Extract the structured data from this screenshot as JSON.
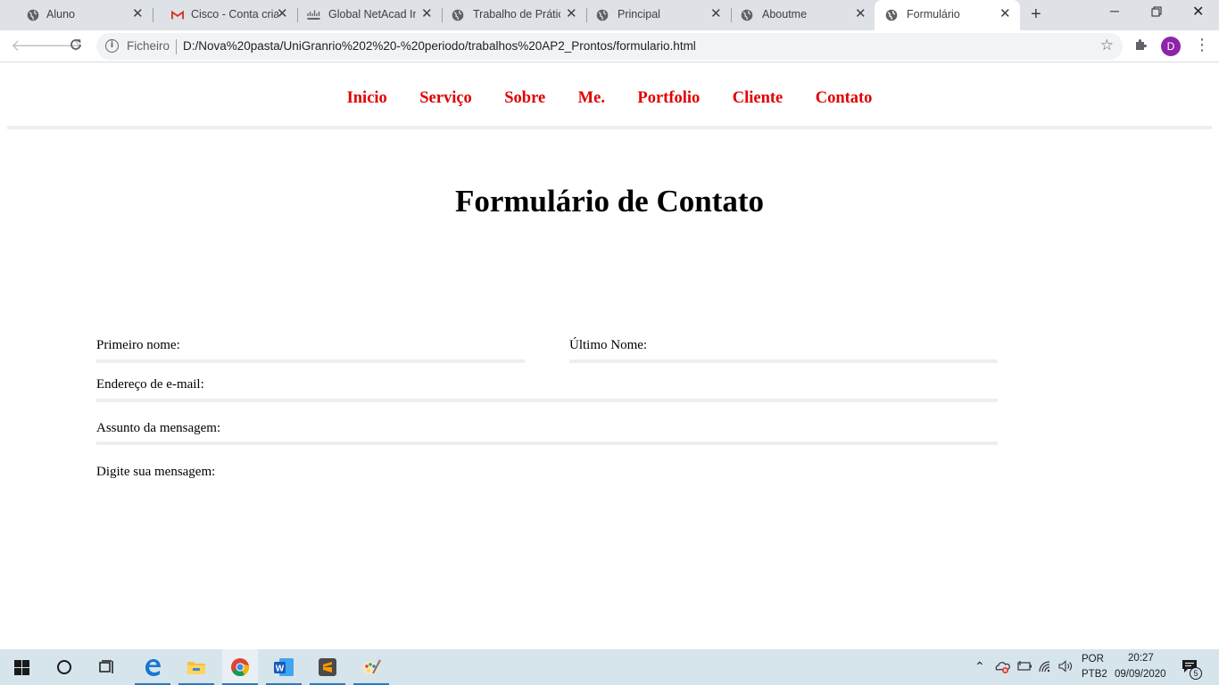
{
  "browser": {
    "tabs": [
      {
        "title": "Aluno",
        "icon": "globe-icon",
        "active": false
      },
      {
        "title": "Cisco - Conta criada",
        "icon": "gmail-icon",
        "active": false
      },
      {
        "title": "Global NetAcad Inf",
        "icon": "cisco-icon",
        "active": false
      },
      {
        "title": "Trabalho de Prática",
        "icon": "globe-icon",
        "active": false
      },
      {
        "title": "Principal",
        "icon": "globe-icon",
        "active": false
      },
      {
        "title": "Aboutme",
        "icon": "globe-icon",
        "active": false
      },
      {
        "title": "Formulário",
        "icon": "globe-icon",
        "active": true
      }
    ],
    "address": {
      "scheme_label": "Ficheiro",
      "url": "D:/Nova%20pasta/UniGranrio%202%20-%20periodo/trabalhos%20AP2_Prontos/formulario.html"
    },
    "profile_initial": "D"
  },
  "page": {
    "nav": [
      "Inicio",
      "Serviço",
      "Sobre",
      "Me.",
      "Portfolio",
      "Cliente",
      "Contato"
    ],
    "nav_color": "#e00000",
    "title": "Formulário de Contato",
    "form": {
      "first_name_label": "Primeiro nome:",
      "last_name_label": "Último Nome:",
      "email_label": "Endereço de e-mail:",
      "subject_label": "Assunto da mensagem:",
      "message_label": "Digite sua mensagem:"
    }
  },
  "taskbar": {
    "apps": [
      "start-icon",
      "search-icon",
      "task-view-icon",
      "edge-icon",
      "file-explorer-icon",
      "chrome-icon",
      "word-icon",
      "sublime-icon",
      "paint-icon"
    ],
    "language": "POR",
    "keyboard": "PTB2",
    "time": "20:27",
    "date": "09/09/2020",
    "notifications": "5"
  }
}
